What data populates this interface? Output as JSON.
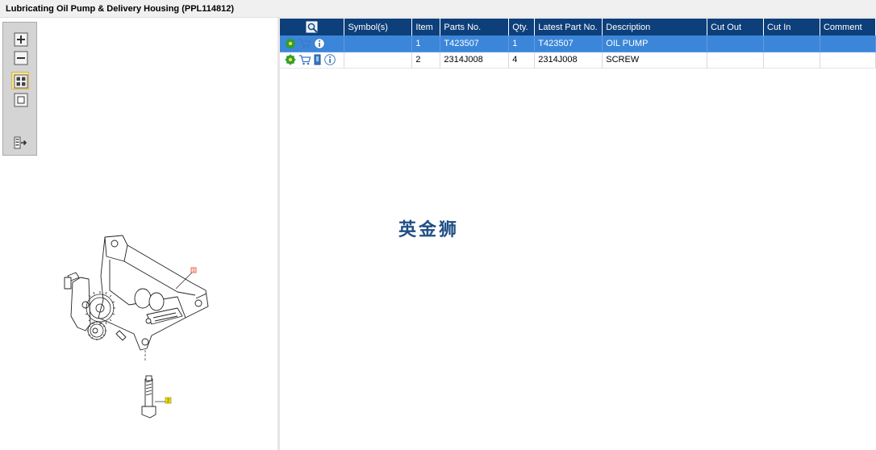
{
  "window": {
    "title": "Lubricating Oil Pump & Delivery Housing (PPL114812)"
  },
  "viewer": {
    "toolbar": [
      {
        "name": "zoom-in-icon"
      },
      {
        "name": "zoom-out-icon"
      },
      {
        "name": "show-all-icon",
        "active": true
      },
      {
        "name": "single-view-icon"
      },
      {
        "name": "export-icon"
      }
    ],
    "callouts": [
      "1",
      "2"
    ],
    "callout_color_1": "#e8402f",
    "callout_color_2": "#f4e400"
  },
  "table": {
    "columns": {
      "icons": "",
      "symbols": "Symbol(s)",
      "item": "Item",
      "parts_no": "Parts No.",
      "qty": "Qty.",
      "latest": "Latest Part No.",
      "description": "Description",
      "cut_out": "Cut Out",
      "cut_in": "Cut In",
      "comment": "Comment"
    },
    "rows": [
      {
        "symbols": "",
        "item": "1",
        "parts_no": "T423507",
        "qty": "1",
        "latest": "T423507",
        "description": "OIL PUMP",
        "cut_out": "",
        "cut_in": "",
        "comment": "",
        "selected": true
      },
      {
        "symbols": "",
        "item": "2",
        "parts_no": "2314J008",
        "qty": "4",
        "latest": "2314J008",
        "description": "SCREW",
        "cut_out": "",
        "cut_in": "",
        "comment": "",
        "selected": false
      }
    ],
    "header_color": "#0d3f7a",
    "selected_color": "#3c86d9"
  },
  "watermark": "英金狮"
}
